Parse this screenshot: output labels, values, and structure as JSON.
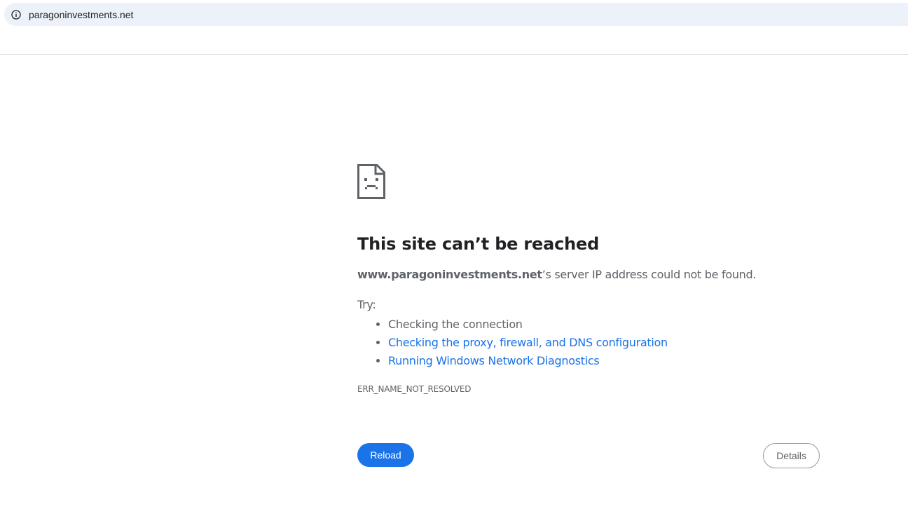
{
  "address_bar": {
    "url": "paragoninvestments.net",
    "icon": "info-icon"
  },
  "error": {
    "icon": "sad-document-icon",
    "title": "This site can’t be reached",
    "host": "www.paragoninvestments.net",
    "message_suffix": "’s server IP address could not be found.",
    "try_label": "Try:",
    "suggestions": [
      "Checking the connection",
      "Checking the proxy, firewall, and DNS configuration",
      "Running Windows Network Diagnostics"
    ],
    "code": "ERR_NAME_NOT_RESOLVED"
  },
  "buttons": {
    "reload": "Reload",
    "details": "Details"
  },
  "colors": {
    "accent": "#1a73e8",
    "text": "#5f6368",
    "title": "#202124",
    "omnibox_bg": "#edf2fa"
  }
}
